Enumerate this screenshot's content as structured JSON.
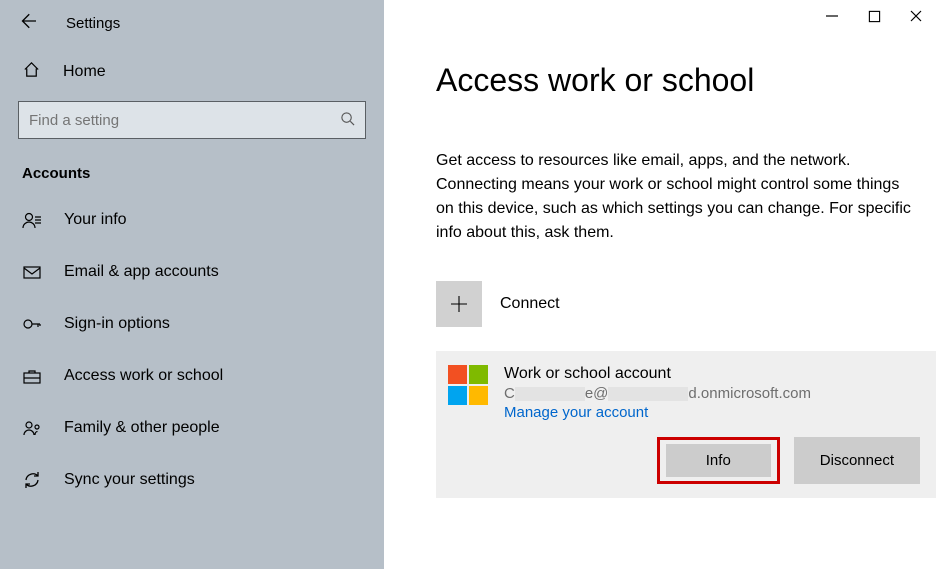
{
  "window": {
    "title": "Settings"
  },
  "sidebar": {
    "home_label": "Home",
    "search_placeholder": "Find a setting",
    "category": "Accounts",
    "items": [
      {
        "label": "Your info"
      },
      {
        "label": "Email & app accounts"
      },
      {
        "label": "Sign-in options"
      },
      {
        "label": "Access work or school"
      },
      {
        "label": "Family & other people"
      },
      {
        "label": "Sync your settings"
      }
    ]
  },
  "main": {
    "title": "Access work or school",
    "description": "Get access to resources like email, apps, and the network. Connecting means your work or school might control some things on this device, such as which settings you can change. For specific info about this, ask them.",
    "connect_label": "Connect",
    "account": {
      "title": "Work or school account",
      "email_prefix": "C",
      "email_mid": "e@",
      "email_suffix": "d.onmicrosoft.com",
      "manage_link": "Manage your account"
    },
    "info_btn": "Info",
    "disconnect_btn": "Disconnect"
  }
}
